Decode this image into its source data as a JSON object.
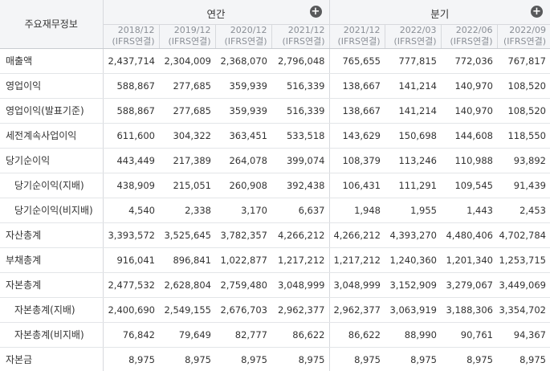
{
  "header": {
    "row_label": "주요재무정보",
    "annual_label": "연간",
    "quarter_label": "분기",
    "annual_periods": [
      {
        "date": "2018/12",
        "basis": "(IFRS연결)"
      },
      {
        "date": "2019/12",
        "basis": "(IFRS연결)"
      },
      {
        "date": "2020/12",
        "basis": "(IFRS연결)"
      },
      {
        "date": "2021/12",
        "basis": "(IFRS연결)"
      }
    ],
    "quarter_periods": [
      {
        "date": "2021/12",
        "basis": "(IFRS연결)"
      },
      {
        "date": "2022/03",
        "basis": "(IFRS연결)"
      },
      {
        "date": "2022/06",
        "basis": "(IFRS연결)"
      },
      {
        "date": "2022/09",
        "basis": "(IFRS연결)"
      }
    ]
  },
  "rows": [
    {
      "label": "매출액",
      "sub": false,
      "values": [
        "2,437,714",
        "2,304,009",
        "2,368,070",
        "2,796,048",
        "765,655",
        "777,815",
        "772,036",
        "767,817"
      ]
    },
    {
      "label": "영업이익",
      "sub": false,
      "values": [
        "588,867",
        "277,685",
        "359,939",
        "516,339",
        "138,667",
        "141,214",
        "140,970",
        "108,520"
      ]
    },
    {
      "label": "영업이익(발표기준)",
      "sub": false,
      "values": [
        "588,867",
        "277,685",
        "359,939",
        "516,339",
        "138,667",
        "141,214",
        "140,970",
        "108,520"
      ]
    },
    {
      "label": "세전계속사업이익",
      "sub": false,
      "values": [
        "611,600",
        "304,322",
        "363,451",
        "533,518",
        "143,629",
        "150,698",
        "144,608",
        "118,550"
      ]
    },
    {
      "label": "당기순이익",
      "sub": false,
      "values": [
        "443,449",
        "217,389",
        "264,078",
        "399,074",
        "108,379",
        "113,246",
        "110,988",
        "93,892"
      ]
    },
    {
      "label": "당기순이익(지배)",
      "sub": true,
      "values": [
        "438,909",
        "215,051",
        "260,908",
        "392,438",
        "106,431",
        "111,291",
        "109,545",
        "91,439"
      ]
    },
    {
      "label": "당기순이익(비지배)",
      "sub": true,
      "values": [
        "4,540",
        "2,338",
        "3,170",
        "6,637",
        "1,948",
        "1,955",
        "1,443",
        "2,453"
      ]
    },
    {
      "label": "자산총계",
      "sub": false,
      "values": [
        "3,393,572",
        "3,525,645",
        "3,782,357",
        "4,266,212",
        "4,266,212",
        "4,393,270",
        "4,480,406",
        "4,702,784"
      ]
    },
    {
      "label": "부채총계",
      "sub": false,
      "values": [
        "916,041",
        "896,841",
        "1,022,877",
        "1,217,212",
        "1,217,212",
        "1,240,360",
        "1,201,340",
        "1,253,715"
      ]
    },
    {
      "label": "자본총계",
      "sub": false,
      "values": [
        "2,477,532",
        "2,628,804",
        "2,759,480",
        "3,048,999",
        "3,048,999",
        "3,152,909",
        "3,279,067",
        "3,449,069"
      ]
    },
    {
      "label": "자본총계(지배)",
      "sub": true,
      "values": [
        "2,400,690",
        "2,549,155",
        "2,676,703",
        "2,962,377",
        "2,962,377",
        "3,063,919",
        "3,188,306",
        "3,354,702"
      ]
    },
    {
      "label": "자본총계(비지배)",
      "sub": true,
      "values": [
        "76,842",
        "79,649",
        "82,777",
        "86,622",
        "86,622",
        "88,990",
        "90,761",
        "94,367"
      ]
    },
    {
      "label": "자본금",
      "sub": false,
      "values": [
        "8,975",
        "8,975",
        "8,975",
        "8,975",
        "8,975",
        "8,975",
        "8,975",
        "8,975"
      ]
    }
  ]
}
